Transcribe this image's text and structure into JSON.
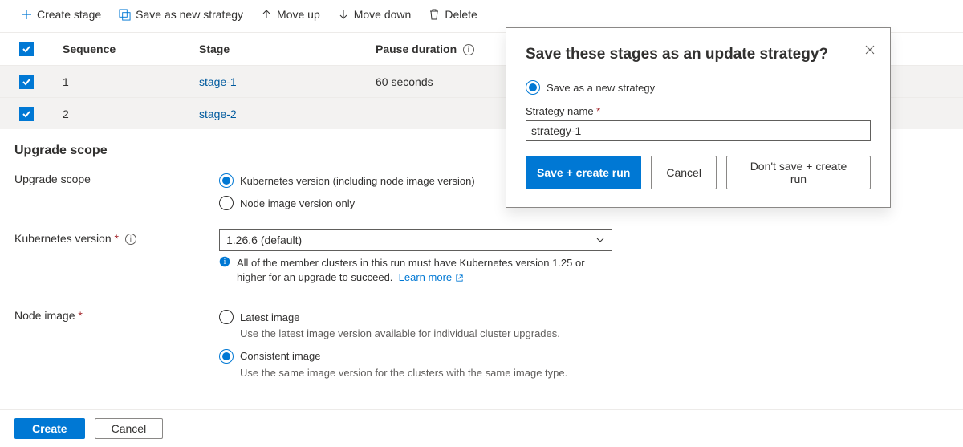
{
  "toolbar": {
    "create_stage": "Create stage",
    "save_as_new_strategy": "Save as new strategy",
    "move_up": "Move up",
    "move_down": "Move down",
    "delete": "Delete"
  },
  "table": {
    "headers": {
      "sequence": "Sequence",
      "stage": "Stage",
      "pause": "Pause duration"
    },
    "rows": [
      {
        "sequence": "1",
        "stage": "stage-1",
        "pause": "60 seconds"
      },
      {
        "sequence": "2",
        "stage": "stage-2",
        "pause": ""
      }
    ]
  },
  "section": {
    "title": "Upgrade scope"
  },
  "form": {
    "upgrade_scope_label": "Upgrade scope",
    "scope_option_full": "Kubernetes version (including node image version)",
    "scope_option_node_only": "Node image version only",
    "k8s_version_label": "Kubernetes version",
    "k8s_version_value": "1.26.6 (default)",
    "k8s_info": "All of the member clusters in this run must have Kubernetes version 1.25 or higher for an upgrade to succeed.",
    "learn_more": "Learn more",
    "node_image_label": "Node image",
    "node_latest": "Latest image",
    "node_latest_desc": "Use the latest image version available for individual cluster upgrades.",
    "node_consistent": "Consistent image",
    "node_consistent_desc": "Use the same image version for the clusters with the same image type."
  },
  "footer": {
    "create": "Create",
    "cancel": "Cancel"
  },
  "dialog": {
    "title": "Save these stages as an update strategy?",
    "option_save_new": "Save as a new strategy",
    "strategy_name_label": "Strategy name",
    "strategy_name_value": "strategy-1",
    "save_create": "Save + create run",
    "cancel": "Cancel",
    "dont_save_create": "Don't save + create run"
  }
}
